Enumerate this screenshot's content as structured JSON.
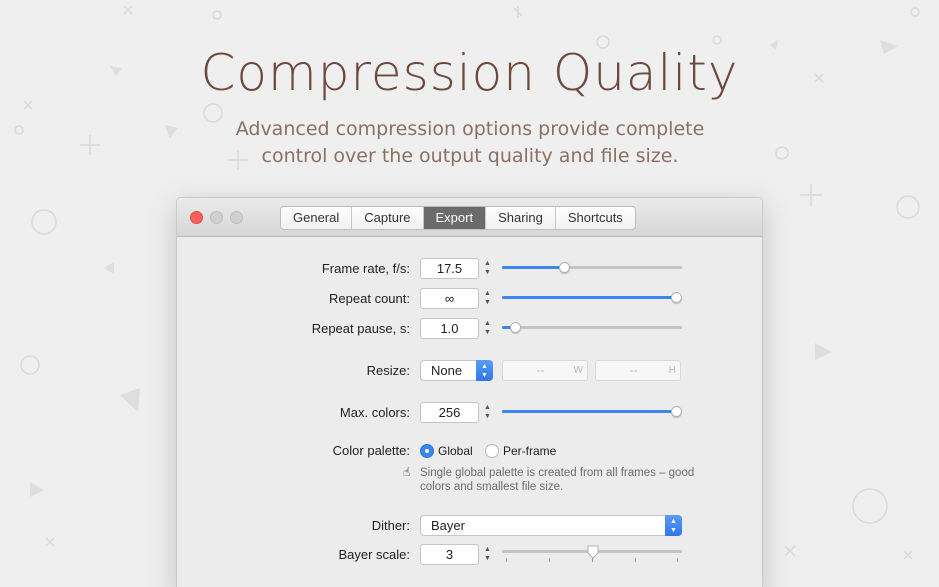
{
  "hero": {
    "title": "Compression Quality",
    "subtitle_line1": "Advanced compression options provide complete",
    "subtitle_line2": "control over the output quality and file size."
  },
  "window": {
    "tabs": [
      {
        "label": "General",
        "active": false
      },
      {
        "label": "Capture",
        "active": false
      },
      {
        "label": "Export",
        "active": true
      },
      {
        "label": "Sharing",
        "active": false
      },
      {
        "label": "Shortcuts",
        "active": false
      }
    ]
  },
  "settings": {
    "frame_rate": {
      "label": "Frame rate, f/s:",
      "value": "17.5",
      "slider_fraction": 0.34
    },
    "repeat_count": {
      "label": "Repeat count:",
      "value": "∞",
      "slider_fraction": 1.0
    },
    "repeat_pause": {
      "label": "Repeat pause, s:",
      "value": "1.0",
      "slider_fraction": 0.05
    },
    "resize": {
      "label": "Resize:",
      "value": "None",
      "width_placeholder": "--",
      "width_suffix": "W",
      "height_placeholder": "--",
      "height_suffix": "H"
    },
    "max_colors": {
      "label": "Max. colors:",
      "value": "256",
      "slider_fraction": 1.0
    },
    "color_palette": {
      "label": "Color palette:",
      "options": [
        {
          "label": "Global",
          "selected": true
        },
        {
          "label": "Per-frame",
          "selected": false
        }
      ],
      "hint_icon": "☝",
      "hint_line1": "Single global palette is created from all frames – good",
      "hint_line2": "colors and smallest file size."
    },
    "dither": {
      "label": "Dither:",
      "value": "Bayer"
    },
    "bayer_scale": {
      "label": "Bayer scale:",
      "value": "3",
      "slider_fraction": 0.5
    }
  },
  "colors": {
    "accent": "#3b87f2",
    "close": "#fc605b",
    "title": "#6b4a3d"
  }
}
